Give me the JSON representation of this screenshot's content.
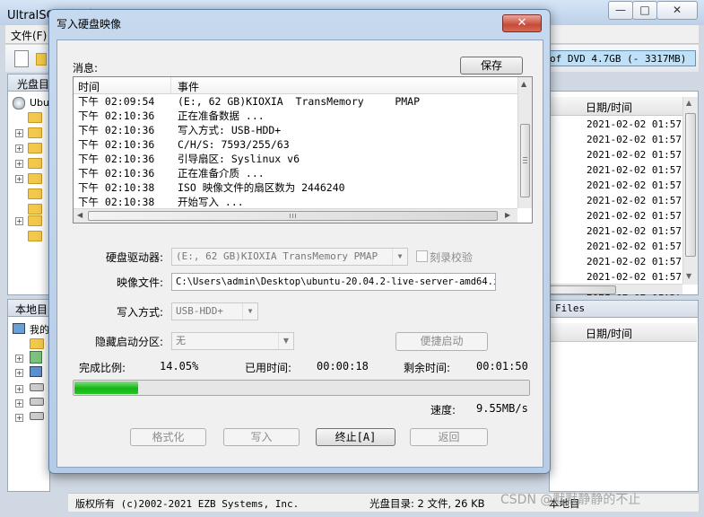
{
  "background": {
    "title_fragment": "UltraISO (试用版) - C:\\Users\\admin\\Desktop\\ubuntu-20.04.2-live-server-amd64.iso",
    "menu_file": "文件(F)",
    "dvd_capacity": "of DVD 4.7GB (- 3317MB)",
    "disc_panel_label": "光盘目",
    "tree_root": "Ubu",
    "local_panel_label": "本地目",
    "local_root": "我的",
    "files_label": "Files",
    "date_header": "日期/时间",
    "date_header_local": "日期/时间",
    "dates": [
      "2021-02-02 01:57",
      "2021-02-02 01:57",
      "2021-02-02 01:57",
      "2021-02-02 01:57",
      "2021-02-02 01:57",
      "2021-02-02 01:57",
      "2021-02-02 01:57",
      "2021-02-02 01:57",
      "2021-02-02 01:57",
      "2021-02-02 01:57",
      "2021-02-02 01:57",
      "2021-02-02 01:57"
    ],
    "status_copyright": "版权所有 (c)2002-2021 EZB Systems, Inc.",
    "status_disc": "光盘目录: 2 文件, 26 KB",
    "status_local": "本地目",
    "watermark": "CSDN @默默静静的不止"
  },
  "dialog": {
    "title": "写入硬盘映像",
    "close_label": "✕",
    "messages_label": "消息:",
    "save_label": "保存",
    "log_headers": {
      "time": "时间",
      "event": "事件"
    },
    "log": [
      {
        "time": "下午 02:09:54",
        "event": "(E:, 62 GB)KIOXIA  TransMemory     PMAP"
      },
      {
        "time": "下午 02:10:36",
        "event": "正在准备数据 ..."
      },
      {
        "time": "下午 02:10:36",
        "event": "写入方式: USB-HDD+"
      },
      {
        "time": "下午 02:10:36",
        "event": "C/H/S: 7593/255/63"
      },
      {
        "time": "下午 02:10:36",
        "event": "引导扇区: Syslinux v6"
      },
      {
        "time": "下午 02:10:36",
        "event": "正在准备介质 ..."
      },
      {
        "time": "下午 02:10:38",
        "event": "ISO 映像文件的扇区数为 2446240"
      },
      {
        "time": "下午 02:10:38",
        "event": "开始写入 ..."
      }
    ],
    "drive_label": "硬盘驱动器:",
    "drive_value": "(E:, 62 GB)KIOXIA  TransMemory     PMAP",
    "verify_label": "刻录校验",
    "image_label": "映像文件:",
    "image_value": "C:\\Users\\admin\\Desktop\\ubuntu-20.04.2-live-server-amd64.iso",
    "method_label": "写入方式:",
    "method_value": "USB-HDD+",
    "hidden_label": "隐藏启动分区:",
    "hidden_value": "无",
    "quick_boot_label": "便捷启动",
    "done_label": "完成比例:",
    "done_value": "14.05%",
    "elapsed_label": "已用时间:",
    "elapsed_value": "00:00:18",
    "remaining_label": "剩余时间:",
    "remaining_value": "00:01:50",
    "progress": 0.1405,
    "speed_label": "速度:",
    "speed_value": "9.55MB/s",
    "format_label": "格式化",
    "write_label": "写入",
    "stop_label": "终止[A]",
    "back_label": "返回"
  },
  "colors": {
    "progress_fill": "#14b514",
    "close_button": "#c74a38",
    "title_bar": "#c7d9ee"
  }
}
